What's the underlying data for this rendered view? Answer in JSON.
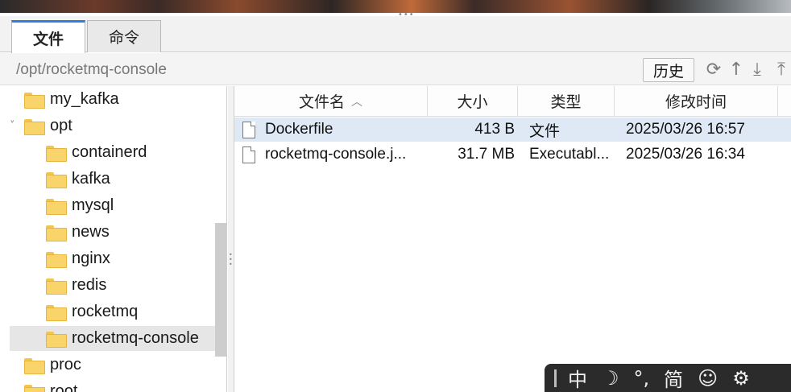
{
  "tabs": [
    {
      "label": "文件",
      "active": true
    },
    {
      "label": "命令",
      "active": false
    }
  ],
  "path": {
    "current": "/opt/rocketmq-console",
    "history_label": "历史",
    "tool_icons": [
      "refresh-icon",
      "up-icon",
      "download-icon",
      "upload-icon"
    ]
  },
  "tree": {
    "items": [
      {
        "label": "my_kafka",
        "level": 0,
        "expanded": false
      },
      {
        "label": "opt",
        "level": 0,
        "expanded": true
      },
      {
        "label": "containerd",
        "level": 1
      },
      {
        "label": "kafka",
        "level": 1
      },
      {
        "label": "mysql",
        "level": 1
      },
      {
        "label": "news",
        "level": 1
      },
      {
        "label": "nginx",
        "level": 1
      },
      {
        "label": "redis",
        "level": 1
      },
      {
        "label": "rocketmq",
        "level": 1
      },
      {
        "label": "rocketmq-console",
        "level": 1,
        "selected": true
      },
      {
        "label": "proc",
        "level": 0
      },
      {
        "label": "root",
        "level": 0
      }
    ]
  },
  "files": {
    "columns": {
      "name": "文件名",
      "size": "大小",
      "type": "类型",
      "modified": "修改时间"
    },
    "rows": [
      {
        "name": "Dockerfile",
        "size": "413 B",
        "type": "文件",
        "modified": "2025/03/26 16:57",
        "selected": true
      },
      {
        "name": "rocketmq-console.j...",
        "size": "31.7 MB",
        "type": "Executabl...",
        "modified": "2025/03/26 16:34",
        "selected": false
      }
    ]
  },
  "ime": {
    "mode": "中",
    "punct": "°,",
    "script": "简"
  },
  "colors": {
    "accent": "#2f7de1",
    "selected_row": "#dfe9f5",
    "folder": "#f8d46a"
  }
}
